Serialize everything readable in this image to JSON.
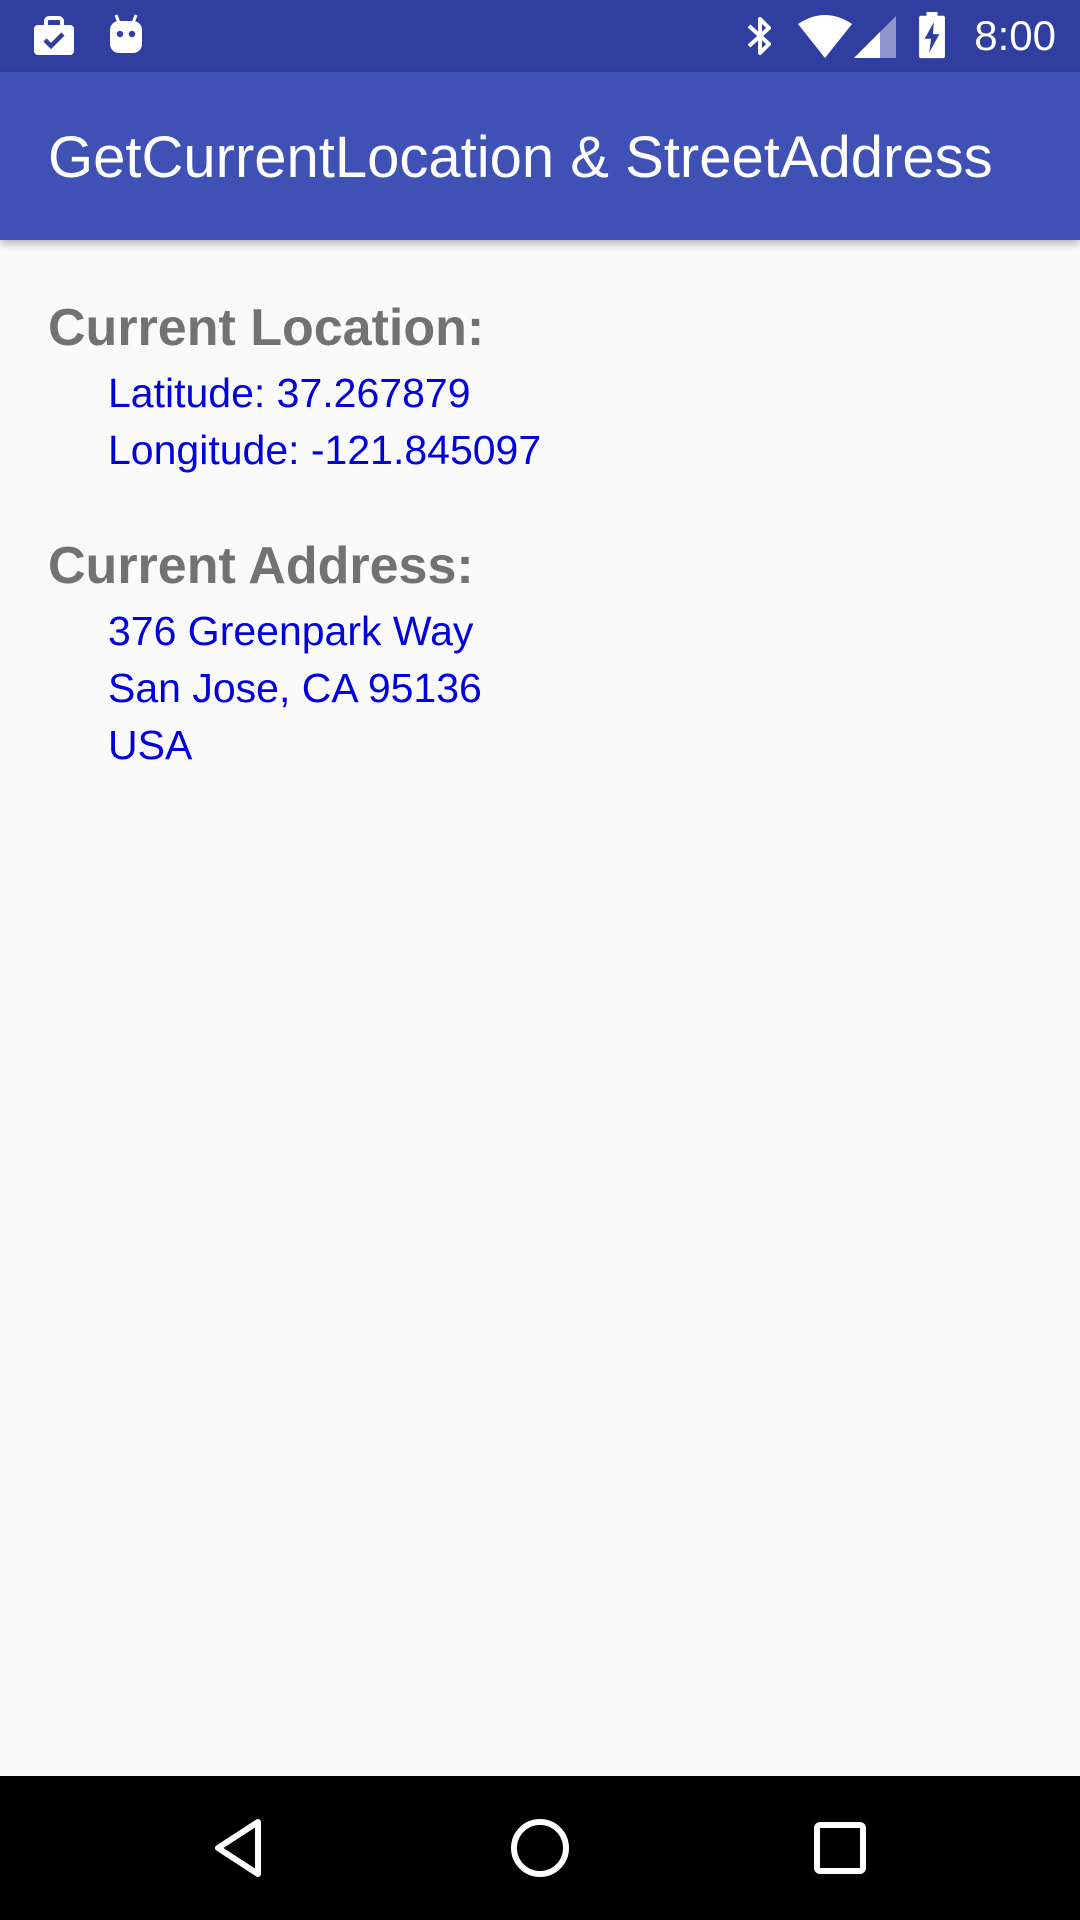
{
  "status_bar": {
    "time": "8:00",
    "icons": [
      "work-briefcase-check-icon",
      "android-debug-icon",
      "bluetooth-icon",
      "wifi-icon",
      "cell-signal-icon",
      "battery-charging-icon"
    ]
  },
  "app_bar": {
    "title": "GetCurrentLocation & StreetAddress"
  },
  "location": {
    "heading": "Current Location:",
    "latitude": "Latitude: 37.267879",
    "longitude": "Longitude: -121.845097"
  },
  "address": {
    "heading": "Current Address:",
    "line1": "376 Greenpark Way",
    "line2": "San Jose, CA 95136",
    "line3": "USA"
  },
  "nav_bar": {
    "icons": [
      "back-icon",
      "home-icon",
      "recents-icon"
    ]
  },
  "colors": {
    "status_bar": "#303f9f",
    "app_bar": "#3f51b5",
    "heading_text": "#727272",
    "value_text": "#0000dd",
    "background": "#fafafa"
  }
}
